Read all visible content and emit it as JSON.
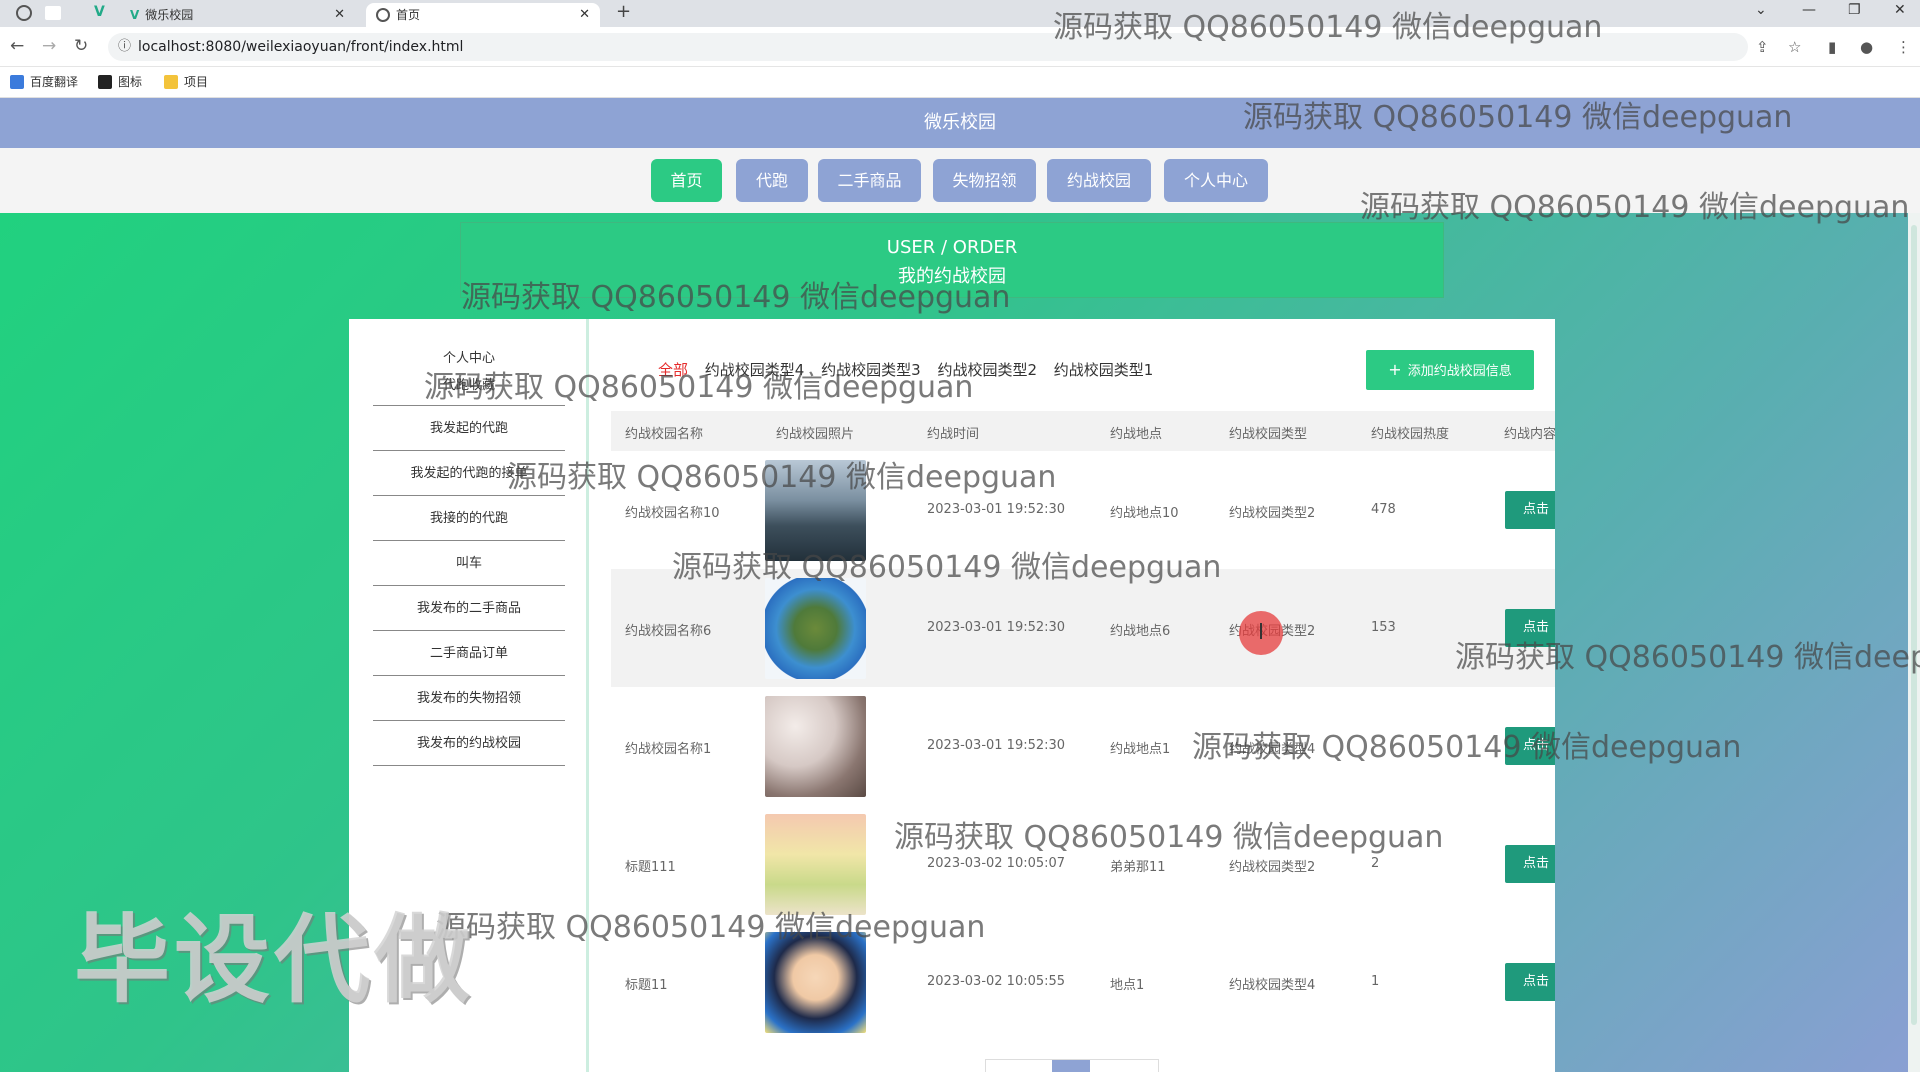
{
  "browser": {
    "tabs": [
      {
        "label": "微乐校园"
      },
      {
        "label": "首页"
      }
    ],
    "url": "localhost:8080/weilexiaoyuan/front/index.html",
    "bookmarks": [
      "百度翻译",
      "图标",
      "项目"
    ]
  },
  "site": {
    "title": "微乐校园",
    "nav": [
      "首页",
      "代跑",
      "二手商品",
      "失物招领",
      "约战校园",
      "个人中心"
    ]
  },
  "hero": {
    "en": "USER / ORDER",
    "cn": "我的约战校园"
  },
  "sidebar": {
    "header": "个人中心",
    "items": [
      "代跑收藏",
      "我发起的代跑",
      "我发起的代跑的接单",
      "我接的的代跑",
      "叫车",
      "我发布的二手商品",
      "二手商品订单",
      "我发布的失物招领",
      "我发布的约战校园"
    ]
  },
  "filters": [
    "全部",
    "约战校园类型4",
    "约战校园类型3",
    "约战校园类型2",
    "约战校园类型1"
  ],
  "add_button": "添加约战校园信息",
  "table": {
    "headers": [
      "约战校园名称",
      "约战校园照片",
      "约战时间",
      "约战地点",
      "约战校园类型",
      "约战校园热度",
      "约战内容"
    ],
    "rows": [
      {
        "name": "约战校园名称10",
        "time": "2023-03-01 19:52:30",
        "place": "约战地点10",
        "type": "约战校园类型2",
        "heat": "478",
        "action": "点击"
      },
      {
        "name": "约战校园名称6",
        "time": "2023-03-01 19:52:30",
        "place": "约战地点6",
        "type": "约战校园类型2",
        "heat": "153",
        "action": "点击"
      },
      {
        "name": "约战校园名称1",
        "time": "2023-03-01 19:52:30",
        "place": "约战地点1",
        "type": "约战校园类型4",
        "heat": "",
        "action": "点击"
      },
      {
        "name": "标题111",
        "time": "2023-03-02 10:05:07",
        "place": "弟弟那11",
        "type": "约战校园类型2",
        "heat": "2",
        "action": "点击"
      },
      {
        "name": "标题11",
        "time": "2023-03-02 10:05:55",
        "place": "地点1",
        "type": "约战校园类型4",
        "heat": "1",
        "action": "点击"
      }
    ]
  },
  "watermarks": {
    "text": "源码获取 QQ86050149 微信deepguan",
    "partial": "源码获取 QQ86050149 微信deep",
    "big": "毕设代做"
  }
}
